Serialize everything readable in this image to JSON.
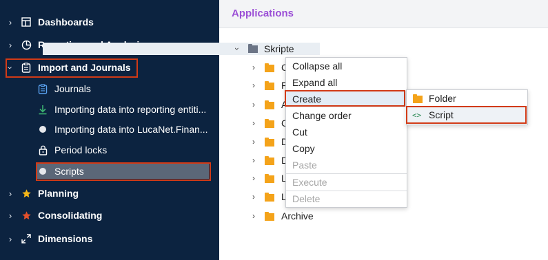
{
  "sidebar": {
    "items": [
      {
        "label": "Dashboards",
        "icon": "dashboard-icon",
        "expanded": false
      },
      {
        "label": "Reporting and Analyzing",
        "icon": "pie-chart-icon",
        "expanded": false
      },
      {
        "label": "Import and Journals",
        "icon": "clipboard-icon",
        "expanded": true
      },
      {
        "label": "Planning",
        "icon": "star-icon",
        "expanded": false
      },
      {
        "label": "Consolidating",
        "icon": "star-icon",
        "expanded": false
      },
      {
        "label": "Dimensions",
        "icon": "expand-arrows-icon",
        "expanded": false
      }
    ],
    "sub_items": [
      {
        "label": "Journals",
        "icon": "journal-icon"
      },
      {
        "label": "Importing data into reporting entiti...",
        "icon": "download-icon"
      },
      {
        "label": "Importing data into LucaNet.Finan...",
        "icon": "circle-icon"
      },
      {
        "label": "Period locks",
        "icon": "lock-icon"
      },
      {
        "label": "Scripts",
        "icon": "circle-icon",
        "selected": true
      }
    ]
  },
  "header": {
    "title": "Applications"
  },
  "tree": {
    "root": "Skripte",
    "children": [
      "C",
      "F",
      "A",
      "C",
      "D",
      "D",
      "L",
      "L",
      "Archive"
    ]
  },
  "context_menu": {
    "items": [
      {
        "label": "Collapse all",
        "disabled": false
      },
      {
        "label": "Expand all",
        "disabled": false
      },
      {
        "label": "Create",
        "disabled": false,
        "has_submenu": true
      },
      {
        "label": "Change order",
        "disabled": false
      },
      {
        "label": "Cut",
        "disabled": false
      },
      {
        "label": "Copy",
        "disabled": false
      },
      {
        "label": "Paste",
        "disabled": true
      },
      {
        "label": "Execute",
        "disabled": true
      },
      {
        "label": "Delete",
        "disabled": true
      }
    ]
  },
  "submenu": {
    "items": [
      {
        "label": "Folder",
        "icon": "folder-icon"
      },
      {
        "label": "Script",
        "icon": "code-icon"
      }
    ]
  },
  "colors": {
    "sidebar_bg": "#0c2340",
    "accent_purple": "#9b4fd6",
    "highlight_red": "#d23a16",
    "folder_orange": "#f4a31a"
  }
}
